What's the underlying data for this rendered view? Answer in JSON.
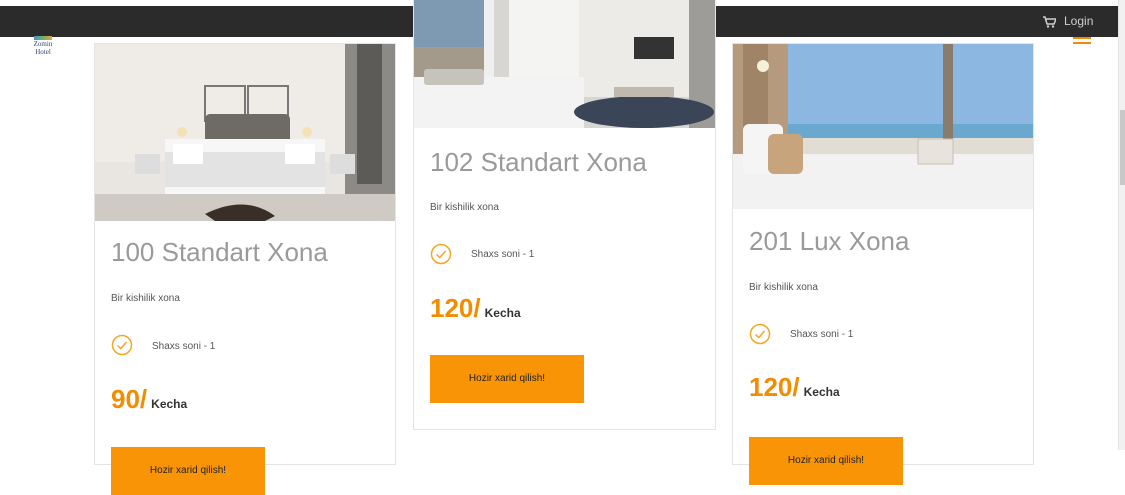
{
  "header": {
    "login_label": "Login",
    "icons": {
      "cart": "cart-icon",
      "menu": "hamburger-menu-icon"
    }
  },
  "logo": {
    "line1": "Zomin",
    "line2": "Hotel"
  },
  "colors": {
    "accent": "#f89406",
    "topbar": "#2b2b2b",
    "title": "#9a9a9a"
  },
  "rooms": [
    {
      "title": "100 Standart Xona",
      "description": "Bir kishilik xona",
      "feature": "Shaxs soni - 1",
      "price": "90/",
      "per": "Kecha",
      "button": "Hozir xarid qilish!"
    },
    {
      "title": "102 Standart Xona",
      "description": "Bir kishilik xona",
      "feature": "Shaxs soni - 1",
      "price": "120/",
      "per": "Kecha",
      "button": "Hozir xarid qilish!"
    },
    {
      "title": "201 Lux Xona",
      "description": "Bir kishilik xona",
      "feature": "Shaxs soni - 1",
      "price": "120/",
      "per": "Kecha",
      "button": "Hozir xarid qilish!"
    }
  ]
}
